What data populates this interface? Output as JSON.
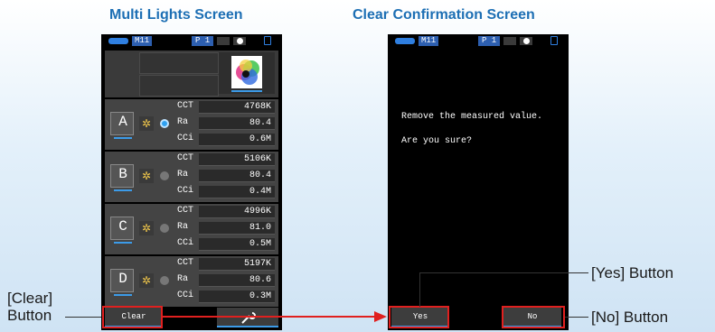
{
  "captions": {
    "left": "Multi Lights Screen",
    "right": "Clear Confirmation Screen"
  },
  "status_bar": {
    "memory": "M11",
    "page": "P 1"
  },
  "multi_lights": {
    "lights": [
      {
        "letter": "A",
        "active": true,
        "cct_label": "CCT",
        "cct": "4768K",
        "ra_label": "Ra",
        "ra": "80.4",
        "cci_label": "CCi",
        "cci": "0.6M"
      },
      {
        "letter": "B",
        "active": false,
        "cct_label": "CCT",
        "cct": "5106K",
        "ra_label": "Ra",
        "ra": "80.4",
        "cci_label": "CCi",
        "cci": "0.4M"
      },
      {
        "letter": "C",
        "active": false,
        "cct_label": "CCT",
        "cct": "4996K",
        "ra_label": "Ra",
        "ra": "81.0",
        "cci_label": "CCi",
        "cci": "0.5M"
      },
      {
        "letter": "D",
        "active": false,
        "cct_label": "CCT",
        "cct": "5197K",
        "ra_label": "Ra",
        "ra": "80.6",
        "cci_label": "CCi",
        "cci": "0.3M"
      }
    ],
    "clear_label": "Clear"
  },
  "confirm": {
    "line1": "Remove the measured value.",
    "line2": "Are you sure?",
    "yes_label": "Yes",
    "no_label": "No"
  },
  "annotations": {
    "clear_line1": "[Clear]",
    "clear_line2": "Button",
    "yes": "[Yes] Button",
    "no": "[No] Button"
  },
  "colors": {
    "caption": "#1d6fb4",
    "highlight": "#e0201f",
    "accent": "#3c9be8"
  }
}
